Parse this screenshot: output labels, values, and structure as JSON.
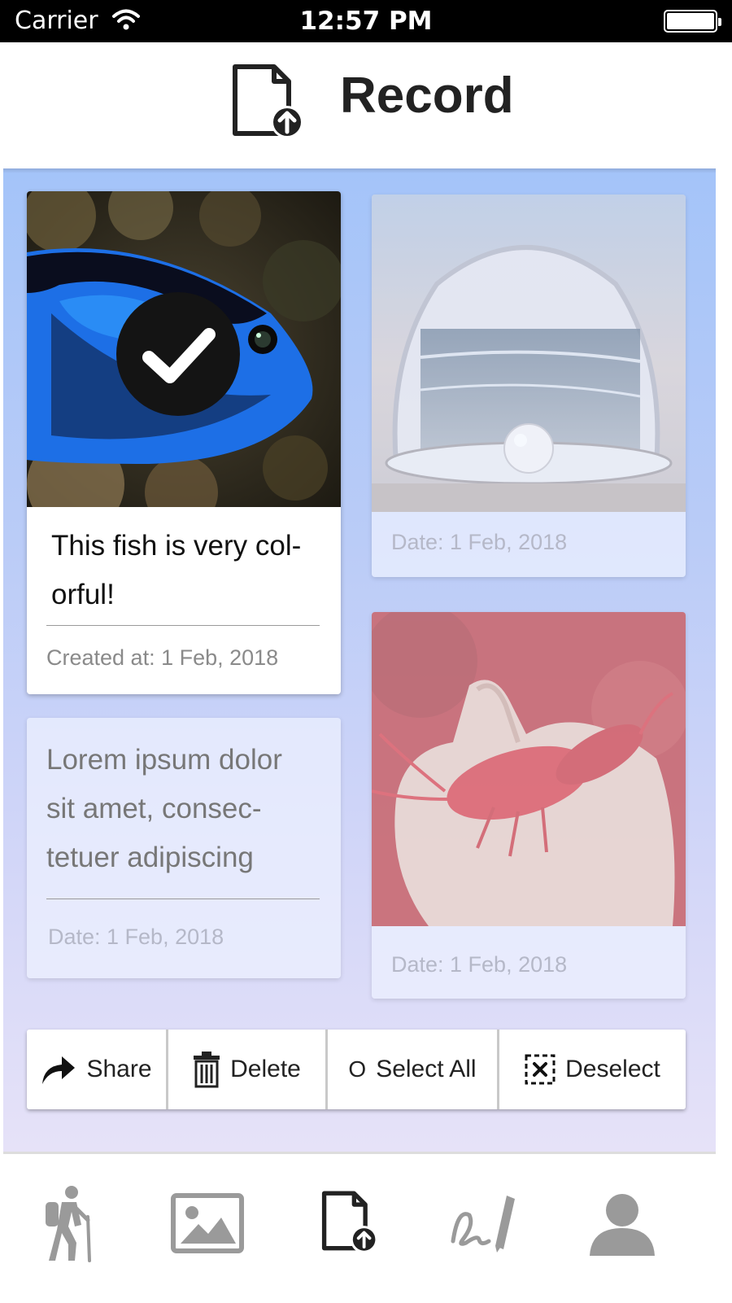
{
  "status_bar": {
    "carrier": "Carrier",
    "time": "12:57 PM"
  },
  "header": {
    "title": "Record",
    "icon": "record-upload-icon"
  },
  "cards": [
    {
      "caption": "This fish is very col-\norful!",
      "date": "Created at: 1 Feb, 2018",
      "image": "blue-tang-fish-photo",
      "selected": true
    },
    {
      "date": "Date: 1 Feb, 2018",
      "image": "pearl-shell-photo",
      "selected": false
    },
    {
      "caption": "Lorem ipsum dolor\nsit amet, consec-\ntetuer adipiscing",
      "date": "Date: 1 Feb, 2018",
      "selected": false
    },
    {
      "date": "Date: 1 Feb, 2018",
      "image": "red-shrimp-in-hand-photo",
      "selected": false
    }
  ],
  "actions": {
    "share": "Share",
    "delete": "Delete",
    "select_all_marker": "O",
    "select_all": "Select All",
    "deselect": "Deselect"
  },
  "tabs": [
    {
      "icon": "hiker-icon",
      "active": false
    },
    {
      "icon": "gallery-icon",
      "active": false
    },
    {
      "icon": "record-upload-icon",
      "active": true
    },
    {
      "icon": "signature-pen-icon",
      "active": false
    },
    {
      "icon": "profile-icon",
      "active": false
    }
  ],
  "colors": {
    "accent_gradient_top": "#a4c4f9",
    "accent_gradient_bottom": "#e6e2f8",
    "tab_active": "#222222",
    "tab_inactive": "#9a9a9a"
  }
}
